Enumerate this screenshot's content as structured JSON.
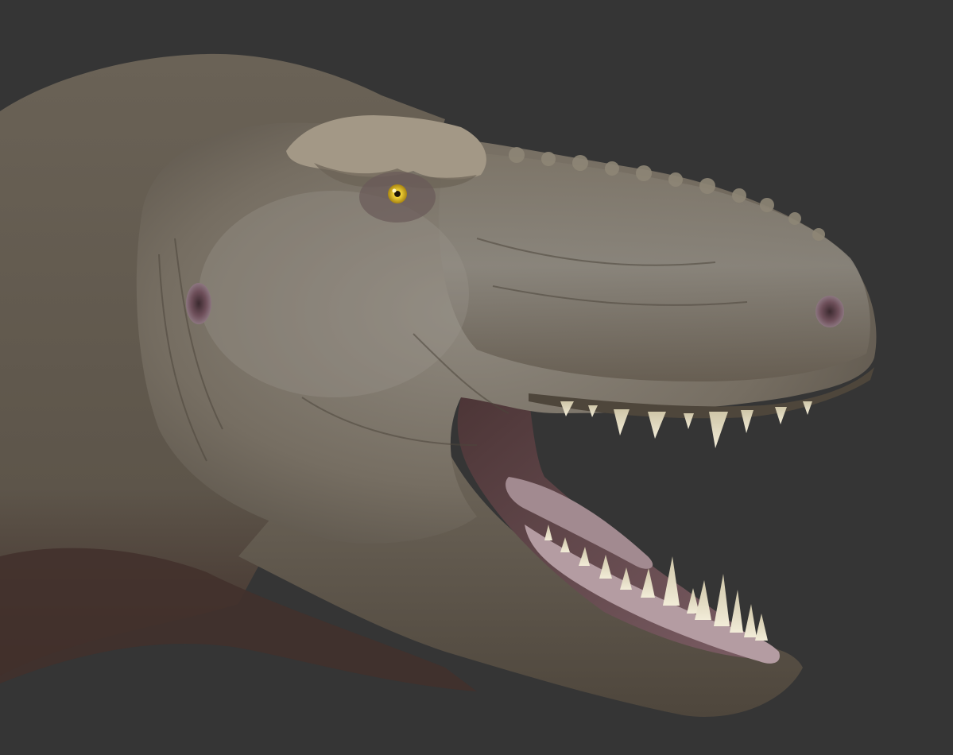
{
  "scene": {
    "background_color": "#353535",
    "subject": "trex-head",
    "skin_color": "#6f675b",
    "skin_light_color": "#8b867c",
    "mouth_color": "#8a6c74",
    "tongue_color": "#a78c93",
    "teeth_color": "#e6dfc8",
    "eye_color": "#e8c21d",
    "brow_color": "#a39886",
    "icons": [
      "eye-icon",
      "nostril-icon",
      "ear-icon",
      "tooth-icon"
    ]
  }
}
